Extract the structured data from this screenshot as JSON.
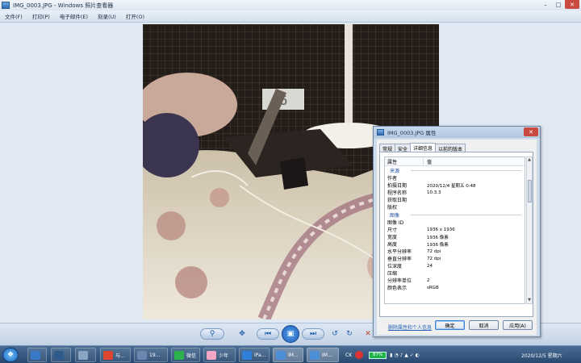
{
  "window": {
    "title": "IMG_0003.JPG - Windows 照片查看器",
    "controls": [
      "–",
      "□",
      "✕"
    ]
  },
  "menu": [
    "文件(F)",
    "打印(P)",
    "电子邮件(E)",
    "刻录(U)",
    "打开(O)"
  ],
  "photo": {
    "clock_display": "46"
  },
  "controls_bar": {
    "zoom": "⚲",
    "fit": "✥",
    "prev": "⏮",
    "slideshow": "▣",
    "next": "⏭",
    "rotate_ccw": "↺",
    "rotate_cw": "↻",
    "delete": "✕"
  },
  "dialog": {
    "title": "IMG_0003.JPG 属性",
    "close": "✕",
    "tabs": [
      "常规",
      "安全",
      "详细信息",
      "以前的版本"
    ],
    "active_tab": "详细信息",
    "header": {
      "name": "属性",
      "value": "值"
    },
    "group_source": "来源",
    "source_rows": [
      {
        "k": "作者",
        "v": ""
      },
      {
        "k": "拍摄日期",
        "v": "2020/12/4 星期五 0:48"
      },
      {
        "k": "程序名称",
        "v": "10.3.3"
      },
      {
        "k": "获取日期",
        "v": ""
      },
      {
        "k": "版权",
        "v": ""
      }
    ],
    "group_image": "图像",
    "image_rows": [
      {
        "k": "图像 ID",
        "v": ""
      },
      {
        "k": "尺寸",
        "v": "1936 x 1936"
      },
      {
        "k": "宽度",
        "v": "1936 像素"
      },
      {
        "k": "高度",
        "v": "1936 像素"
      },
      {
        "k": "水平分辨率",
        "v": "72 dpi"
      },
      {
        "k": "垂直分辨率",
        "v": "72 dpi"
      },
      {
        "k": "位深度",
        "v": "24"
      },
      {
        "k": "压缩",
        "v": ""
      },
      {
        "k": "分辨率单位",
        "v": "2"
      },
      {
        "k": "颜色表示",
        "v": "sRGB"
      }
    ],
    "remove_link": "删除属性和个人信息",
    "buttons": {
      "ok": "确定",
      "cancel": "取消",
      "apply": "应用(A)"
    }
  },
  "taskbar": {
    "start": "❖",
    "items": [
      {
        "label": "",
        "color": "#3a78c8"
      },
      {
        "label": "",
        "color": "#2e5a8c"
      },
      {
        "label": "",
        "color": "#8aa4c2"
      },
      {
        "label": "与...",
        "color": "#e0452f"
      },
      {
        "label": "19...",
        "color": "#6b86b0"
      },
      {
        "label": "微信",
        "color": "#2bb24c"
      },
      {
        "label": "少年",
        "color": "#f1a6c4"
      },
      {
        "label": "iPa...",
        "color": "#2f7fd8"
      },
      {
        "label": "IM...",
        "color": "#4d8fd6"
      },
      {
        "label": "IM...",
        "color": "#4d8fd6"
      }
    ],
    "tray_ck": "CK",
    "battery": "87%",
    "clock": "2020/12/5 星期六"
  }
}
